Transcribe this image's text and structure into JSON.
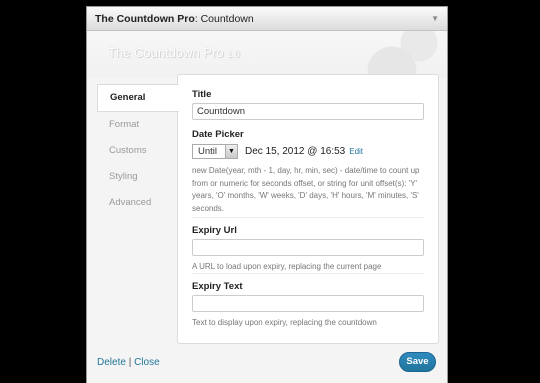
{
  "window": {
    "title_bold": "The Countdown Pro",
    "title_rest": ": Countdown",
    "collapse_icon": "triangle-down-icon"
  },
  "banner": {
    "heading": "The Countdown Pro",
    "version": "1.0"
  },
  "sidebar": {
    "tabs": [
      {
        "label": "General",
        "active": true
      },
      {
        "label": "Format",
        "active": false
      },
      {
        "label": "Customs",
        "active": false
      },
      {
        "label": "Styling",
        "active": false
      },
      {
        "label": "Advanced",
        "active": false
      }
    ]
  },
  "form": {
    "title": {
      "label": "Title",
      "value": "Countdown"
    },
    "date_picker": {
      "label": "Date Picker",
      "mode": "Until",
      "date_text": "Dec 15, 2012 @ 16:53",
      "edit_label": "Edit",
      "hint": "new Date(year, mth - 1, day, hr, min, sec) - date/time to count up from or numeric for seconds offset, or string for unit offset(s): 'Y' years, 'O' months, 'W' weeks, 'D' days, 'H' hours, 'M' minutes, 'S' seconds."
    },
    "expiry_url": {
      "label": "Expiry Url",
      "value": "",
      "hint": "A URL to load upon expiry, replacing the current page"
    },
    "expiry_text": {
      "label": "Expiry Text",
      "value": "",
      "hint": "Text to display upon expiry, replacing the countdown"
    }
  },
  "footer": {
    "delete_label": "Delete",
    "separator": "|",
    "close_label": "Close",
    "save_label": "Save"
  }
}
